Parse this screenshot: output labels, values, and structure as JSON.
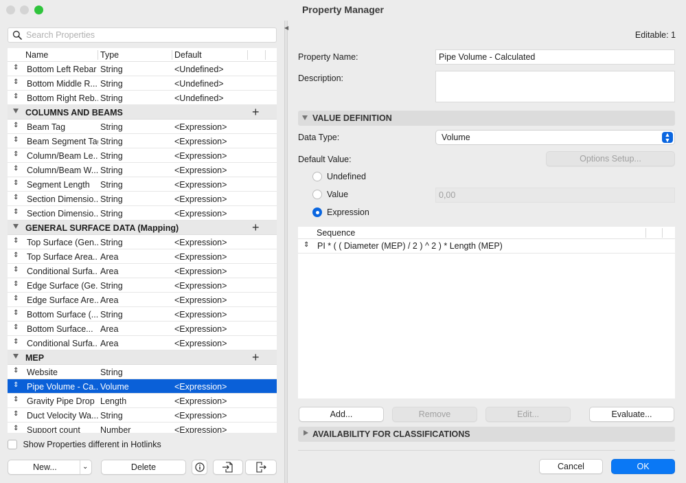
{
  "window": {
    "title": "Property Manager"
  },
  "left": {
    "search_placeholder": "Search Properties",
    "columns": [
      "Name",
      "Type",
      "Default"
    ],
    "top_rows": [
      {
        "name": "Bottom Left Rebar",
        "type": "String",
        "default": "<Undefined>"
      },
      {
        "name": "Bottom Middle R...",
        "type": "String",
        "default": "<Undefined>"
      },
      {
        "name": "Bottom Right Reb...",
        "type": "String",
        "default": "<Undefined>"
      }
    ],
    "groups": [
      {
        "name": "COLUMNS AND BEAMS",
        "rows": [
          {
            "name": "Beam Tag",
            "type": "String",
            "default": "<Expression>"
          },
          {
            "name": "Beam Segment Tag",
            "type": "String",
            "default": "<Expression>"
          },
          {
            "name": "Column/Beam Le...",
            "type": "String",
            "default": "<Expression>"
          },
          {
            "name": "Column/Beam W...",
            "type": "String",
            "default": "<Expression>"
          },
          {
            "name": "Segment Length",
            "type": "String",
            "default": "<Expression>"
          },
          {
            "name": "Section Dimensio...",
            "type": "String",
            "default": "<Expression>"
          },
          {
            "name": "Section Dimensio...",
            "type": "String",
            "default": "<Expression>"
          }
        ]
      },
      {
        "name": "GENERAL SURFACE DATA (Mapping)",
        "rows": [
          {
            "name": "Top Surface (Gen...",
            "type": "String",
            "default": "<Expression>"
          },
          {
            "name": "Top Surface Area...",
            "type": "Area",
            "default": "<Expression>"
          },
          {
            "name": "Conditional Surfa...",
            "type": "Area",
            "default": "<Expression>"
          },
          {
            "name": "Edge Surface (Ge...",
            "type": "String",
            "default": "<Expression>"
          },
          {
            "name": "Edge Surface Are...",
            "type": "Area",
            "default": "<Expression>"
          },
          {
            "name": "Bottom Surface (...",
            "type": "String",
            "default": "<Expression>"
          },
          {
            "name": "Bottom Surface...",
            "type": "Area",
            "default": "<Expression>"
          },
          {
            "name": "Conditional Surfa...",
            "type": "Area",
            "default": "<Expression>"
          }
        ]
      },
      {
        "name": "MEP",
        "rows": [
          {
            "name": "Website",
            "type": "String",
            "default": ""
          },
          {
            "name": "Pipe Volume - Ca...",
            "type": "Volume",
            "default": "<Expression>",
            "selected": true
          },
          {
            "name": "Gravity Pipe Drop",
            "type": "Length",
            "default": "<Expression>"
          },
          {
            "name": "Duct Velocity Wa...",
            "type": "String",
            "default": "<Expression>"
          },
          {
            "name": "Support count",
            "type": "Number",
            "default": "<Expression>"
          }
        ]
      }
    ],
    "hotlinks_label": "Show Properties different in Hotlinks",
    "new_label": "New...",
    "delete_label": "Delete"
  },
  "right": {
    "editable": "Editable: 1",
    "property_name_label": "Property Name:",
    "property_name_value": "Pipe Volume - Calculated",
    "description_label": "Description:",
    "description_value": "",
    "value_definition_title": "VALUE DEFINITION",
    "data_type_label": "Data Type:",
    "data_type_value": "Volume",
    "default_value_label": "Default Value:",
    "options_setup_label": "Options Setup...",
    "radio_undefined": "Undefined",
    "radio_value": "Value",
    "radio_expression": "Expression",
    "value_field": "0,00",
    "sequence_header": "Sequence",
    "sequence_rows": [
      "PI * ( ( Diameter (MEP) / 2 ) ^ 2 ) * Length (MEP)"
    ],
    "add_label": "Add...",
    "remove_label": "Remove",
    "edit_label": "Edit...",
    "evaluate_label": "Evaluate...",
    "availability_title": "AVAILABILITY FOR CLASSIFICATIONS",
    "cancel_label": "Cancel",
    "ok_label": "OK"
  }
}
